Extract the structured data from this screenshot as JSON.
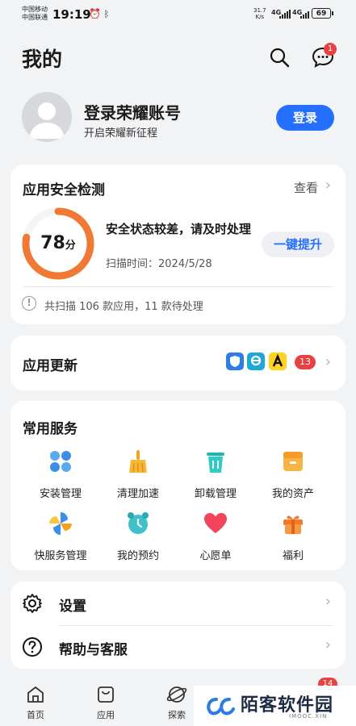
{
  "status_bar": {
    "carrier_1": "中国移动",
    "carrier_2": "中国联通",
    "time": "19:19",
    "net_speed": "31.7",
    "net_unit": "K/s",
    "signal_1": "4G",
    "signal_2": "4G",
    "battery": "69"
  },
  "header": {
    "title": "我的",
    "message_badge": "1"
  },
  "profile": {
    "name": "登录荣耀账号",
    "subtitle": "开启荣耀新征程",
    "login_label": "登录"
  },
  "security": {
    "title": "应用安全检测",
    "view_label": "查看",
    "score": 78,
    "score_unit": "分",
    "status_text": "安全状态较差，请及时处理",
    "scan_time": "扫描时间：2024/5/28",
    "fix_label": "一键提升",
    "scan_summary": "共扫描 106 款应用，11 款待处理"
  },
  "updates": {
    "title": "应用更新",
    "count": "13"
  },
  "services": {
    "title": "常用服务",
    "items": [
      {
        "label": "安装管理",
        "icon": "clover-icon"
      },
      {
        "label": "清理加速",
        "icon": "broom-icon"
      },
      {
        "label": "卸载管理",
        "icon": "trash-icon"
      },
      {
        "label": "我的资产",
        "icon": "box-icon"
      },
      {
        "label": "快服务管理",
        "icon": "pinwheel-icon"
      },
      {
        "label": "我的预约",
        "icon": "alarm-clock-icon"
      },
      {
        "label": "心愿单",
        "icon": "heart-icon"
      },
      {
        "label": "福利",
        "icon": "gift-icon"
      }
    ]
  },
  "settings": {
    "settings_label": "设置",
    "help_label": "帮助与客服"
  },
  "tabbar": {
    "tabs": [
      {
        "label": "首页"
      },
      {
        "label": "应用"
      },
      {
        "label": "探索"
      }
    ],
    "badge": "14"
  },
  "watermark": {
    "text": "陌客软件园",
    "sub": "IMOOC.XIN"
  },
  "colors": {
    "accent": "#256fff",
    "danger": "#e84141",
    "ring_orange": "#f07a35"
  }
}
